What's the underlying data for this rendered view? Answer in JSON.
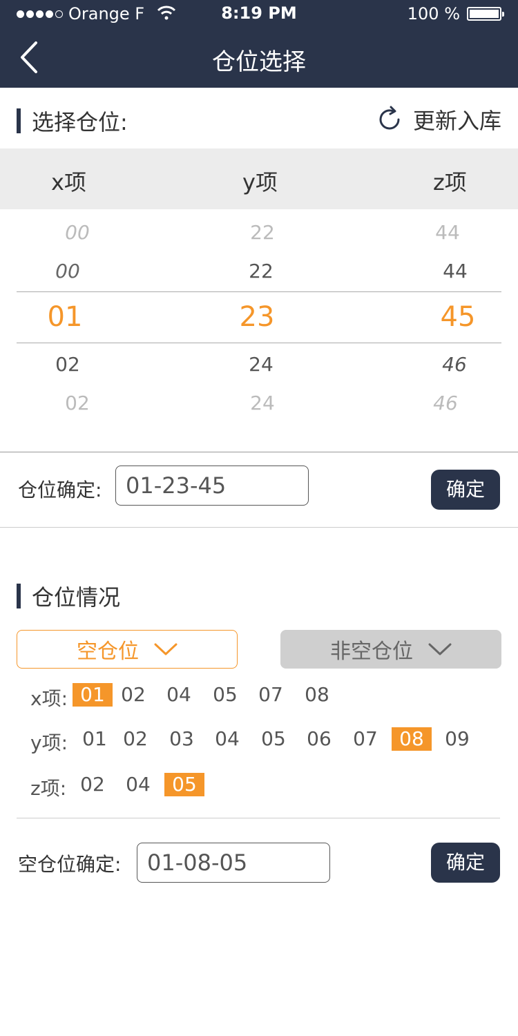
{
  "status_bar": {
    "carrier": "Orange F",
    "time": "8:19 PM",
    "battery": "100 %"
  },
  "nav": {
    "title": "仓位选择"
  },
  "select_section": {
    "title": "选择仓位:",
    "refresh_label": "更新入库"
  },
  "picker": {
    "columns": [
      "x项",
      "y项",
      "z项"
    ],
    "x": {
      "far_above": "00",
      "above": "00",
      "selected": "01",
      "below": "02",
      "far_below": "02"
    },
    "y": {
      "far_above": "22",
      "above": "22",
      "selected": "23",
      "below": "24",
      "far_below": "24"
    },
    "z": {
      "far_above": "44",
      "above": "44",
      "selected": "45",
      "below": "46",
      "far_below": "46"
    }
  },
  "position_confirm": {
    "label": "仓位确定:",
    "value": "01-23-45",
    "button": "确定"
  },
  "status_section": {
    "title": "仓位情况"
  },
  "filters": {
    "empty_label": "空仓位",
    "nonempty_label": "非空仓位"
  },
  "rows": {
    "x": {
      "label": "x项:",
      "options": [
        "01",
        "02",
        "04",
        "05",
        "07",
        "08"
      ],
      "selected": "01"
    },
    "y": {
      "label": "y项:",
      "options": [
        "01",
        "02",
        "03",
        "04",
        "05",
        "06",
        "07",
        "08",
        "09"
      ],
      "selected": "08"
    },
    "z": {
      "label": "z项:",
      "options": [
        "02",
        "04",
        "05"
      ],
      "selected": "05"
    }
  },
  "empty_confirm": {
    "label": "空仓位确定:",
    "value": "01-08-05",
    "button": "确定"
  },
  "colors": {
    "nav": "#2a344a",
    "accent": "#f5962a",
    "header_gray": "#ececec"
  }
}
